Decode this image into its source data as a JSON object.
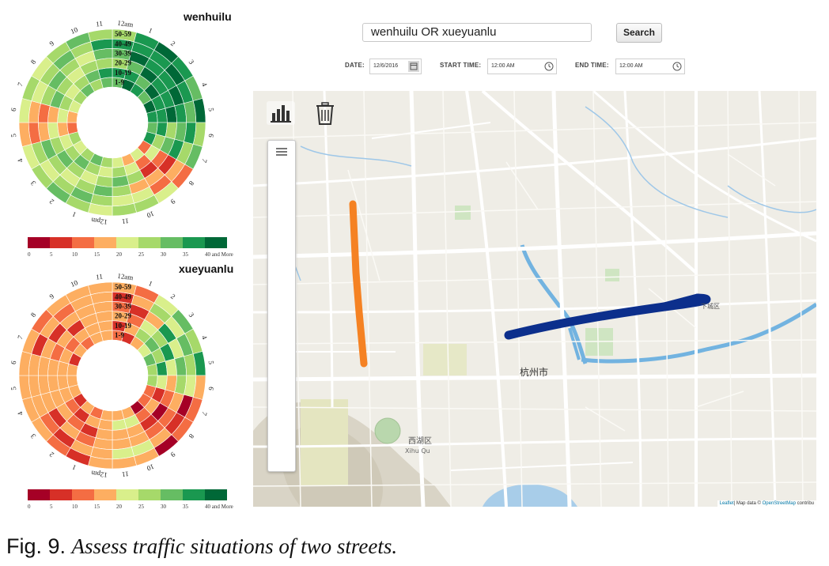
{
  "radial_charts": [
    {
      "title": "wenhuilu",
      "ring_labels": [
        "50-59",
        "40-49",
        "30-39",
        "20-29",
        "10-19",
        "1-9"
      ],
      "hour_labels": [
        "12am",
        "1",
        "2",
        "3",
        "4",
        "5",
        "6",
        "7",
        "8",
        "9",
        "10",
        "11",
        "12pm",
        "1",
        "2",
        "3",
        "4",
        "5",
        "6",
        "7",
        "8",
        "9",
        "10",
        "11"
      ],
      "palette": "green"
    },
    {
      "title": "xueyuanlu",
      "ring_labels": [
        "50-59",
        "40-49",
        "30-39",
        "20-29",
        "10-19",
        "1-9"
      ],
      "hour_labels": [
        "12am",
        "1",
        "2",
        "3",
        "4",
        "5",
        "6",
        "7",
        "8",
        "9",
        "10",
        "11",
        "12pm",
        "1",
        "2",
        "3",
        "4",
        "5",
        "6",
        "7",
        "8",
        "9",
        "10",
        "11"
      ],
      "palette": "orange"
    }
  ],
  "legend": {
    "ticks": [
      "0",
      "5",
      "10",
      "15",
      "20",
      "25",
      "30",
      "35",
      "40 and More"
    ],
    "colors": [
      "#a50026",
      "#d73027",
      "#f46d43",
      "#fdae61",
      "#d9ef8b",
      "#a6d96a",
      "#66bd63",
      "#1a9850",
      "#006837"
    ]
  },
  "search": {
    "query": "wenhuilu   OR   xueyuanlu",
    "button_label": "Search"
  },
  "controls": {
    "date_label": "DATE:",
    "date_value": "12/6/2016",
    "start_label": "START TIME:",
    "start_value": "12:00 AM",
    "end_label": "END TIME:",
    "end_value": "12:00 AM"
  },
  "map": {
    "city_label": "杭州市",
    "district_label": "西湖区",
    "district_pinyin": "Xihu Qu",
    "district2_label": "下城区",
    "attribution_leaflet": "Leaflet",
    "attribution_text": "| Map data © ",
    "attribution_osm": "OpenStreetMap",
    "attribution_more": " contribu",
    "street_colors": {
      "wenhuilu": "#f58223",
      "xueyuanlu": "#0c2f8c",
      "river": "#72b3e0"
    }
  },
  "caption": {
    "label": "Fig. 9.",
    "text": "Assess traffic situations of two streets."
  }
}
